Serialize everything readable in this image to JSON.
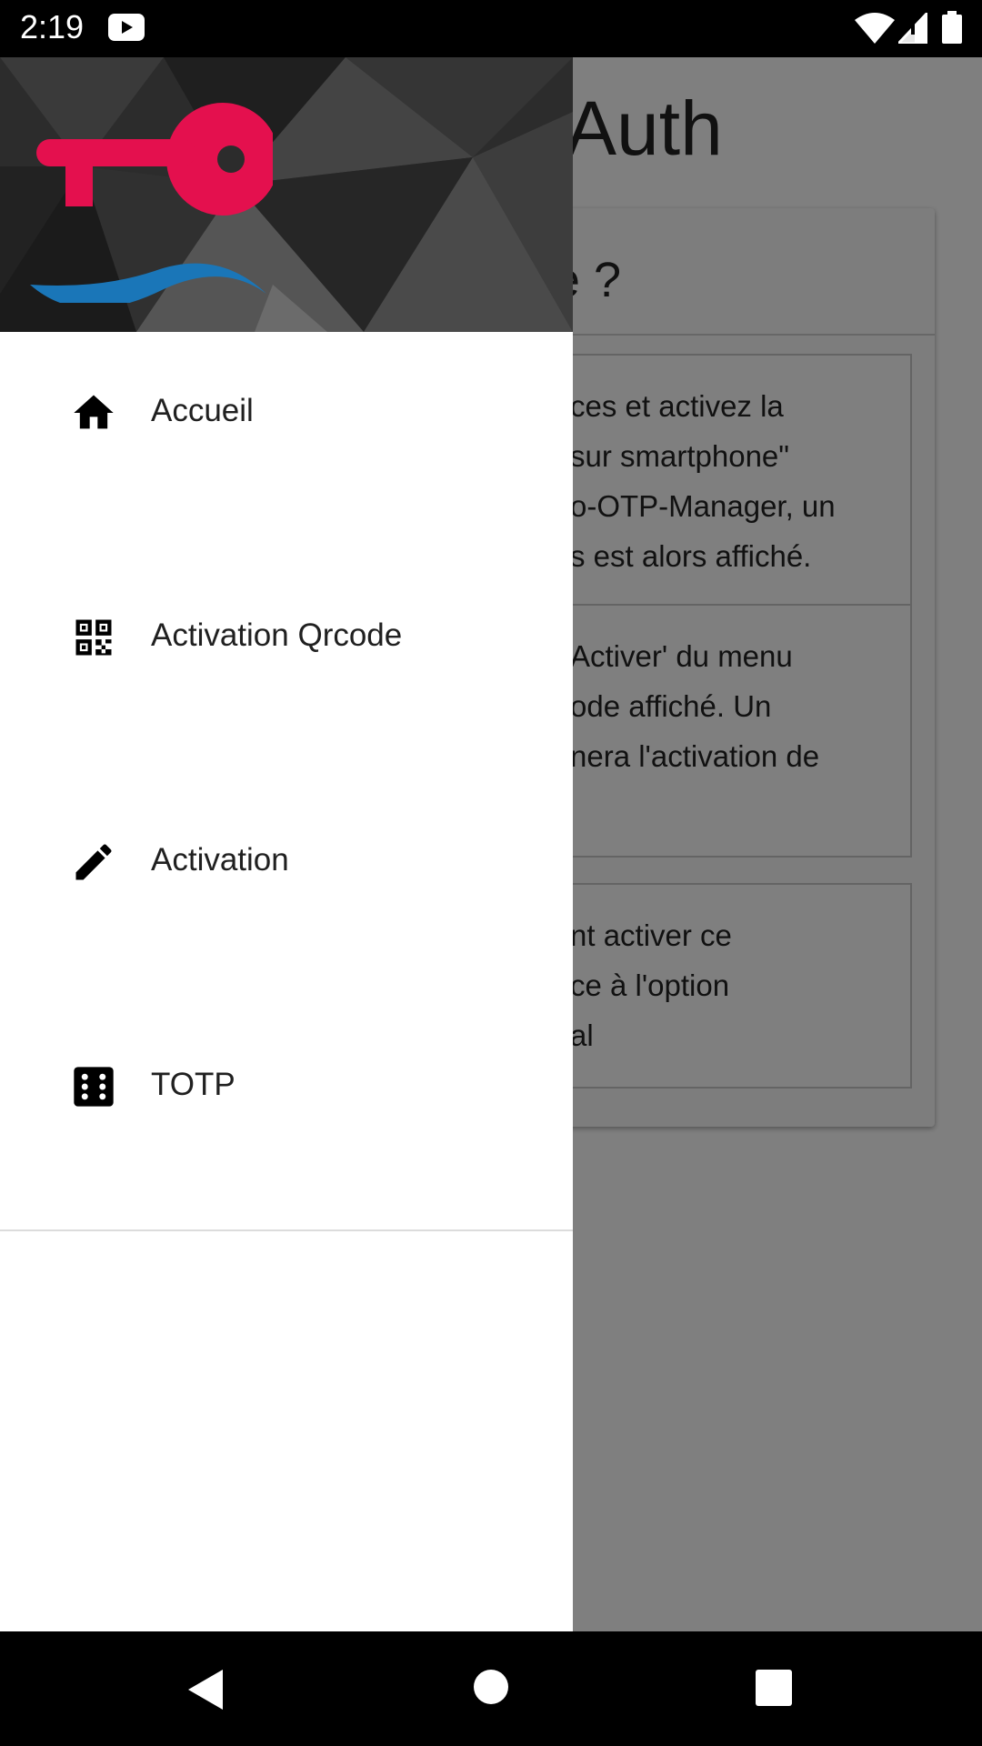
{
  "status_bar": {
    "time": "2:19",
    "icons": [
      "youtube-icon",
      "wifi-icon",
      "cell-signal-icon",
      "battery-icon"
    ]
  },
  "app": {
    "title": "Auth",
    "card_heading": "e ?",
    "step1_lines": [
      "ces et activez la",
      " sur smartphone\"",
      "o-OTP-Manager, un",
      "s est alors affiché."
    ],
    "step2_lines": [
      "Activer' du menu",
      "ode affiché. Un",
      "nera l'activation de"
    ],
    "step3_lines": [
      "nt activer ce",
      "ce à l'option",
      "al"
    ]
  },
  "drawer": {
    "header_logo": "key-logo",
    "colors": {
      "key": "#e4104e",
      "wave": "#1a76b8"
    },
    "items": [
      {
        "label": "Accueil",
        "icon": "home-icon"
      },
      {
        "label": "Activation Qrcode",
        "icon": "qrcode-icon"
      },
      {
        "label": "Activation",
        "icon": "pencil-icon"
      },
      {
        "label": "TOTP",
        "icon": "dice-icon"
      }
    ]
  },
  "nav_bar": {
    "icons": [
      "back-icon",
      "home-circle-icon",
      "recents-icon"
    ]
  }
}
